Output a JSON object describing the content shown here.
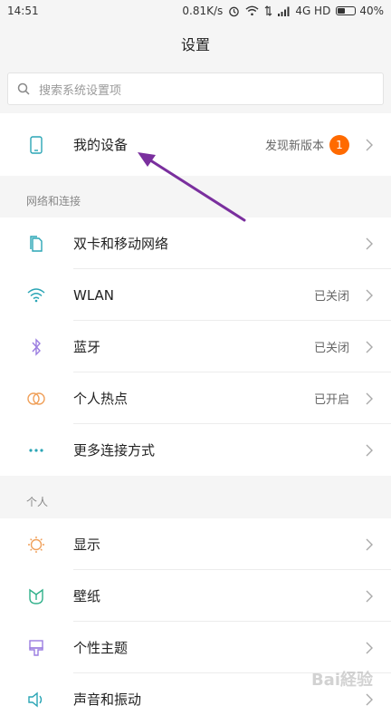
{
  "status_bar": {
    "time": "14:51",
    "speed": "0.81K/s",
    "network": "4G HD",
    "battery": "40%",
    "battery_level": 0.4
  },
  "header": {
    "title": "设置"
  },
  "search": {
    "placeholder": "搜索系统设置项"
  },
  "my_device": {
    "label": "我的设备",
    "value": "发现新版本",
    "badge": "1"
  },
  "sections": {
    "network": "网络和连接",
    "personal": "个人"
  },
  "network_items": [
    {
      "label": "双卡和移动网络",
      "value": ""
    },
    {
      "label": "WLAN",
      "value": "已关闭"
    },
    {
      "label": "蓝牙",
      "value": "已关闭"
    },
    {
      "label": "个人热点",
      "value": "已开启"
    },
    {
      "label": "更多连接方式",
      "value": ""
    }
  ],
  "personal_items": [
    {
      "label": "显示",
      "value": ""
    },
    {
      "label": "壁纸",
      "value": ""
    },
    {
      "label": "个性主题",
      "value": ""
    },
    {
      "label": "声音和振动",
      "value": ""
    }
  ],
  "icons": {
    "phone": "phone-icon",
    "sim": "sim-card-icon",
    "wifi": "wifi-icon",
    "bluetooth": "bluetooth-icon",
    "hotspot": "hotspot-icon",
    "more": "more-dots-icon",
    "display": "sun-icon",
    "wallpaper": "wallpaper-icon",
    "theme": "theme-brush-icon",
    "sound": "sound-icon"
  },
  "colors": {
    "accent_badge": "#ff6a00",
    "icon_teal": "#2aa5b5",
    "icon_purple": "#9b7de0",
    "icon_orange": "#f0a05a",
    "icon_green": "#2fb08a",
    "arrow": "#7a2f9e"
  },
  "watermark": "Bai経验"
}
